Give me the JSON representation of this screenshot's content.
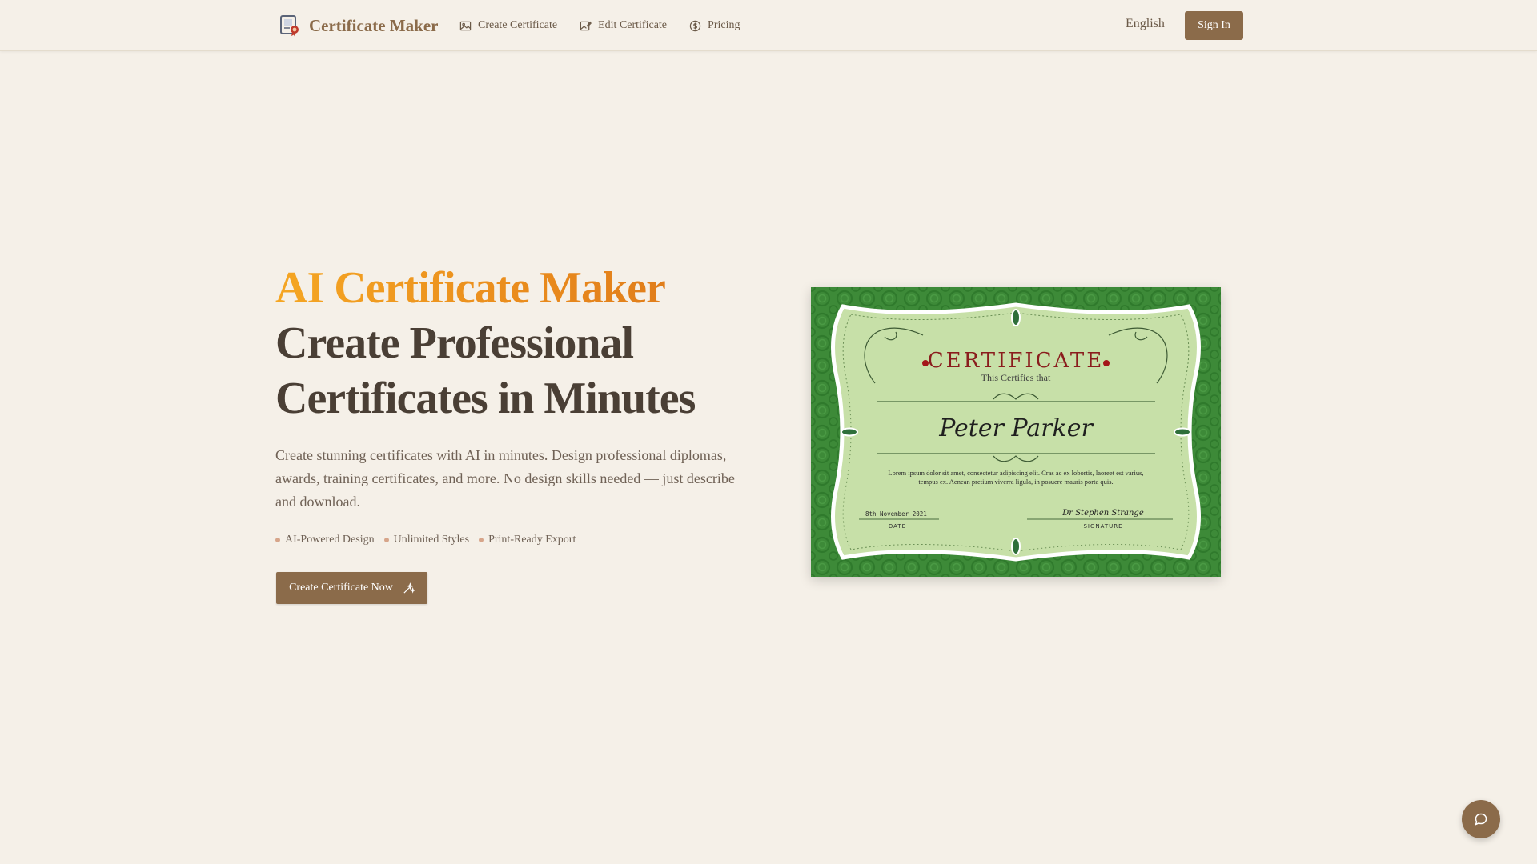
{
  "header": {
    "logo_text": "Certificate Maker",
    "nav": [
      {
        "label": "Create Certificate",
        "icon": "image-icon"
      },
      {
        "label": "Edit Certificate",
        "icon": "image-edit-icon"
      },
      {
        "label": "Pricing",
        "icon": "dollar-circle-icon"
      }
    ],
    "language": "English",
    "signin_label": "Sign In"
  },
  "hero": {
    "title_accent": "AI Certificate Maker",
    "title_main": "Create Professional Certificates in Minutes",
    "description": "Create stunning certificates with AI in minutes. Design professional diplomas, awards, training certificates, and more. No design skills needed — just describe and download.",
    "features": [
      "AI-Powered Design",
      "Unlimited Styles",
      "Print-Ready Export"
    ],
    "cta_label": "Create Certificate Now",
    "cta_icon": "sparkle-icon"
  },
  "certificate_preview": {
    "heading": "CERTIFICATE",
    "subheading": "This Certifies that",
    "recipient": "Peter Parker",
    "body": "Lorem ipsum dolor sit amet, consectetur adipiscing elit. Cras ac ex lobortis, laoreet est varius, tempus ex. Aenean pretium viverra ligula, in posuere mauris porta quis.",
    "date_value": "8th November 2021",
    "date_label": "DATE",
    "signature_value": "Dr Stephen Strange",
    "signature_label": "SIGNATURE"
  },
  "chat_icon": "chat-bubble-icon",
  "colors": {
    "background": "#f5f0e8",
    "brand": "#8b6b4a",
    "accent_start": "#f5a623",
    "accent_end": "#d9731a",
    "certificate_green": "#3d8a38",
    "certificate_paper": "#c7e0a8",
    "certificate_title": "#8a1d1d"
  }
}
